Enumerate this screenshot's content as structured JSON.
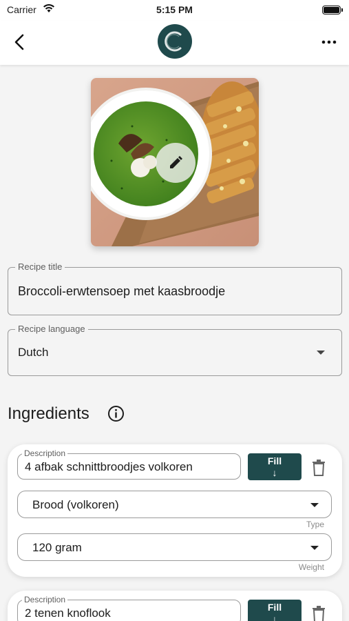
{
  "status_bar": {
    "carrier": "Carrier",
    "time": "5:15 PM",
    "battery_level": 1.0
  },
  "nav": {
    "back_icon": "chevron-left-icon",
    "more_icon": "more-horizontal-icon",
    "logo_icon": "app-logo-icon"
  },
  "photo": {
    "edit_icon": "pencil-icon"
  },
  "recipe_title": {
    "label": "Recipe title",
    "value": "Broccoli-erwtensoep met kaasbroodje"
  },
  "recipe_language": {
    "label": "Recipe language",
    "value": "Dutch"
  },
  "ingredients": {
    "title": "Ingredients",
    "info_icon": "info-icon",
    "items": [
      {
        "description_label": "Description",
        "description": "4 afbak schnittbroodjes volkoren",
        "fill_label": "Fill",
        "fill_arrow": "↓",
        "type": "Brood (volkoren)",
        "type_helper": "Type",
        "weight": "120 gram",
        "weight_helper": "Weight"
      },
      {
        "description_label": "Description",
        "description": "2 tenen knoflook",
        "fill_label": "Fill",
        "fill_arrow": "↓"
      }
    ]
  },
  "colors": {
    "accent": "#1f4a4c",
    "background": "#f4f4f4",
    "card": "#ffffff",
    "border": "#9a9a9a"
  }
}
